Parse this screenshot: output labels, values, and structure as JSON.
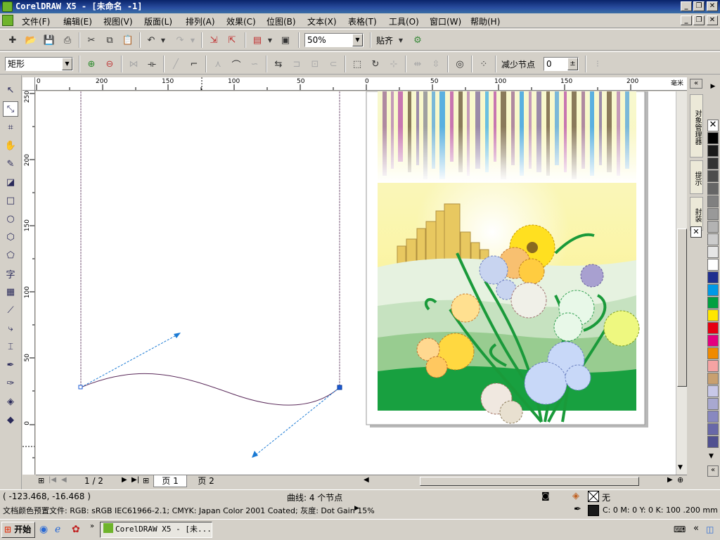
{
  "window": {
    "title": "CorelDRAW X5 - [未命名 -1]",
    "min": "_",
    "restore": "❐",
    "close": "✕"
  },
  "menu": {
    "items": [
      "文件(F)",
      "编辑(E)",
      "视图(V)",
      "版面(L)",
      "排列(A)",
      "效果(C)",
      "位图(B)",
      "文本(X)",
      "表格(T)",
      "工具(O)",
      "窗口(W)",
      "帮助(H)"
    ]
  },
  "toolbar": {
    "zoom": "50%",
    "snap": "贴齐"
  },
  "property_bar": {
    "shape_type": "矩形",
    "reduce_nodes_label": "减少节点",
    "reduce_nodes_value": "0"
  },
  "rulers": {
    "unit": "毫米",
    "h_labels": [
      "0",
      "200",
      "150",
      "100",
      "50",
      "0",
      "50",
      "100",
      "150",
      "200"
    ],
    "v_labels": [
      "250",
      "200",
      "150",
      "100",
      "50",
      "0"
    ]
  },
  "pages": {
    "counter": "1 / 2",
    "tab1": "页 1",
    "tab2": "页 2"
  },
  "status": {
    "coords": "( -123.468, -16.468 )",
    "object_info": "曲线: 4 个节点",
    "fill_label": "无",
    "color_profile": "文档颜色预置文件: RGB: sRGB IEC61966-2.1; CMYK: Japan Color 2001 Coated; 灰度: Dot Gain 15%",
    "outline_info": "C: 0 M: 0 Y: 0 K: 100  .200 mm"
  },
  "docker": {
    "tab1": "对象管理器",
    "tab2": "提示",
    "tab3": "封装"
  },
  "taskbar": {
    "start": "开始",
    "task": "CorelDRAW X5 - [未..."
  },
  "palette_colors": [
    "#000000",
    "#1a1a1a",
    "#333333",
    "#4d4d4d",
    "#666666",
    "#808080",
    "#999999",
    "#b3b3b3",
    "#cccccc",
    "#e6e6e6",
    "#ffffff",
    "#1f2f8f",
    "#0099e6",
    "#00a040",
    "#ffe600",
    "#e60012",
    "#e4007f",
    "#f08a00",
    "#f5a3a3",
    "#c8a070",
    "#c8c8e8",
    "#a8a8d0",
    "#8888c0",
    "#6868a8",
    "#505090"
  ],
  "colors": {
    "accent": "#0a246a",
    "canvas": "#ffffff",
    "chrome": "#d4d0c8"
  }
}
